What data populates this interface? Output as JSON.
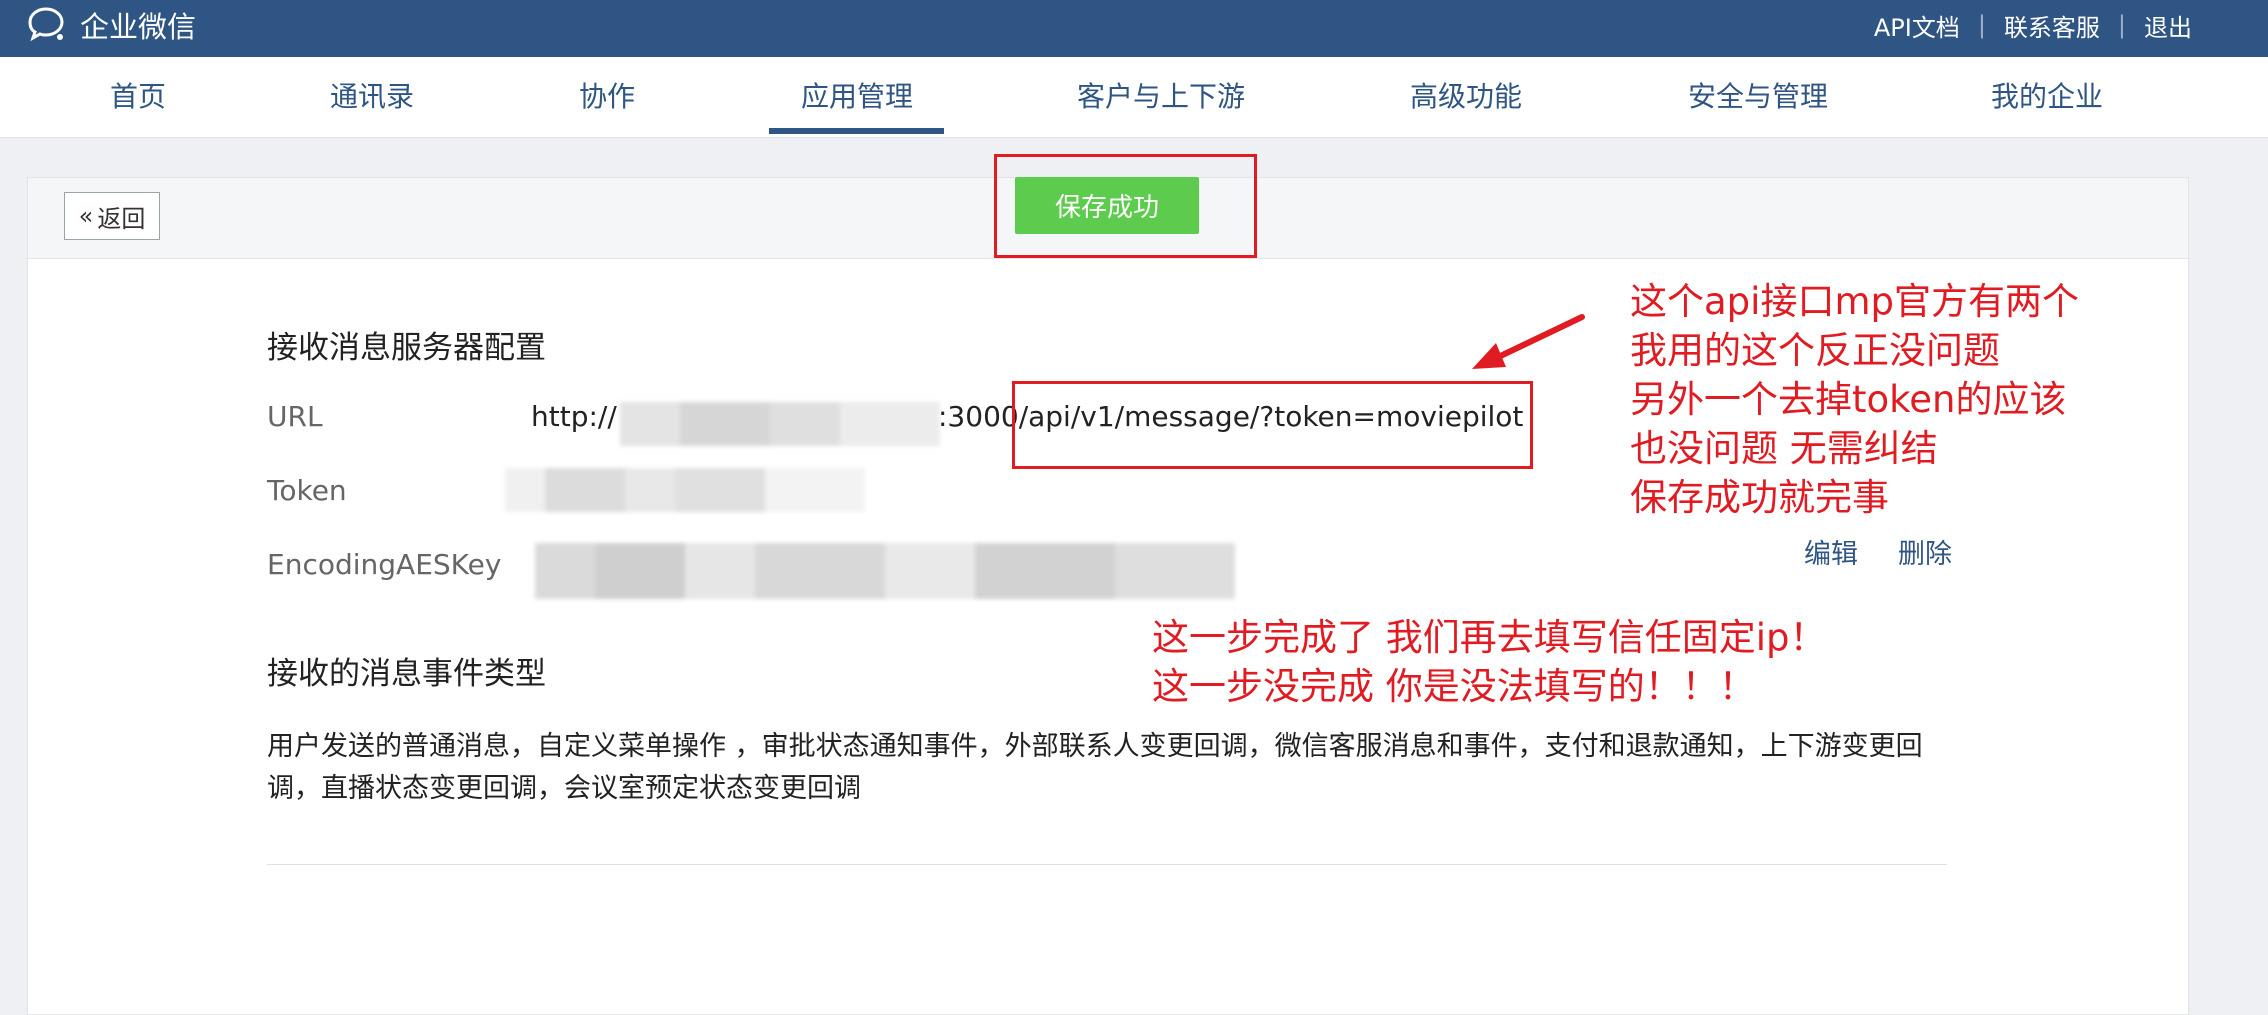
{
  "topbar": {
    "brand": "企业微信",
    "links": [
      "API文档",
      "联系客服",
      "退出"
    ]
  },
  "nav": {
    "items": [
      "首页",
      "通讯录",
      "协作",
      "应用管理",
      "客户与上下游",
      "高级功能",
      "安全与管理",
      "我的企业"
    ],
    "active": "应用管理"
  },
  "page": {
    "back_label": "返回",
    "toast": "保存成功",
    "config_title": "接收消息服务器配置",
    "fields": {
      "url_label": "URL",
      "url_prefix": "http://",
      "url_suffix": ":3000/api/v1/message/?token=moviepilot",
      "token_label": "Token",
      "aes_label": "EncodingAESKey"
    },
    "actions": {
      "edit": "编辑",
      "delete": "删除"
    },
    "events_title": "接收的消息事件类型",
    "events_text": "用户发送的普通消息，自定义菜单操作 ，审批状态通知事件，外部联系人变更回调，微信客服消息和事件，支付和退款通知，上下游变更回调，直播状态变更回调，会议室预定状态变更回调"
  },
  "annotations": {
    "note_right": [
      "这个api接口mp官方有两个",
      "我用的这个反正没问题",
      "另外一个去掉token的应该",
      "也没问题 无需纠结",
      "保存成功就完事"
    ],
    "note_bottom": [
      "这一步完成了 我们再去填写信任固定ip！",
      "这一步没完成 你是没法填写的！！！"
    ],
    "color": "#e11b22"
  },
  "colors": {
    "topbar": "#2f5584",
    "toast": "#5dcb4d",
    "link": "#2f5584"
  }
}
